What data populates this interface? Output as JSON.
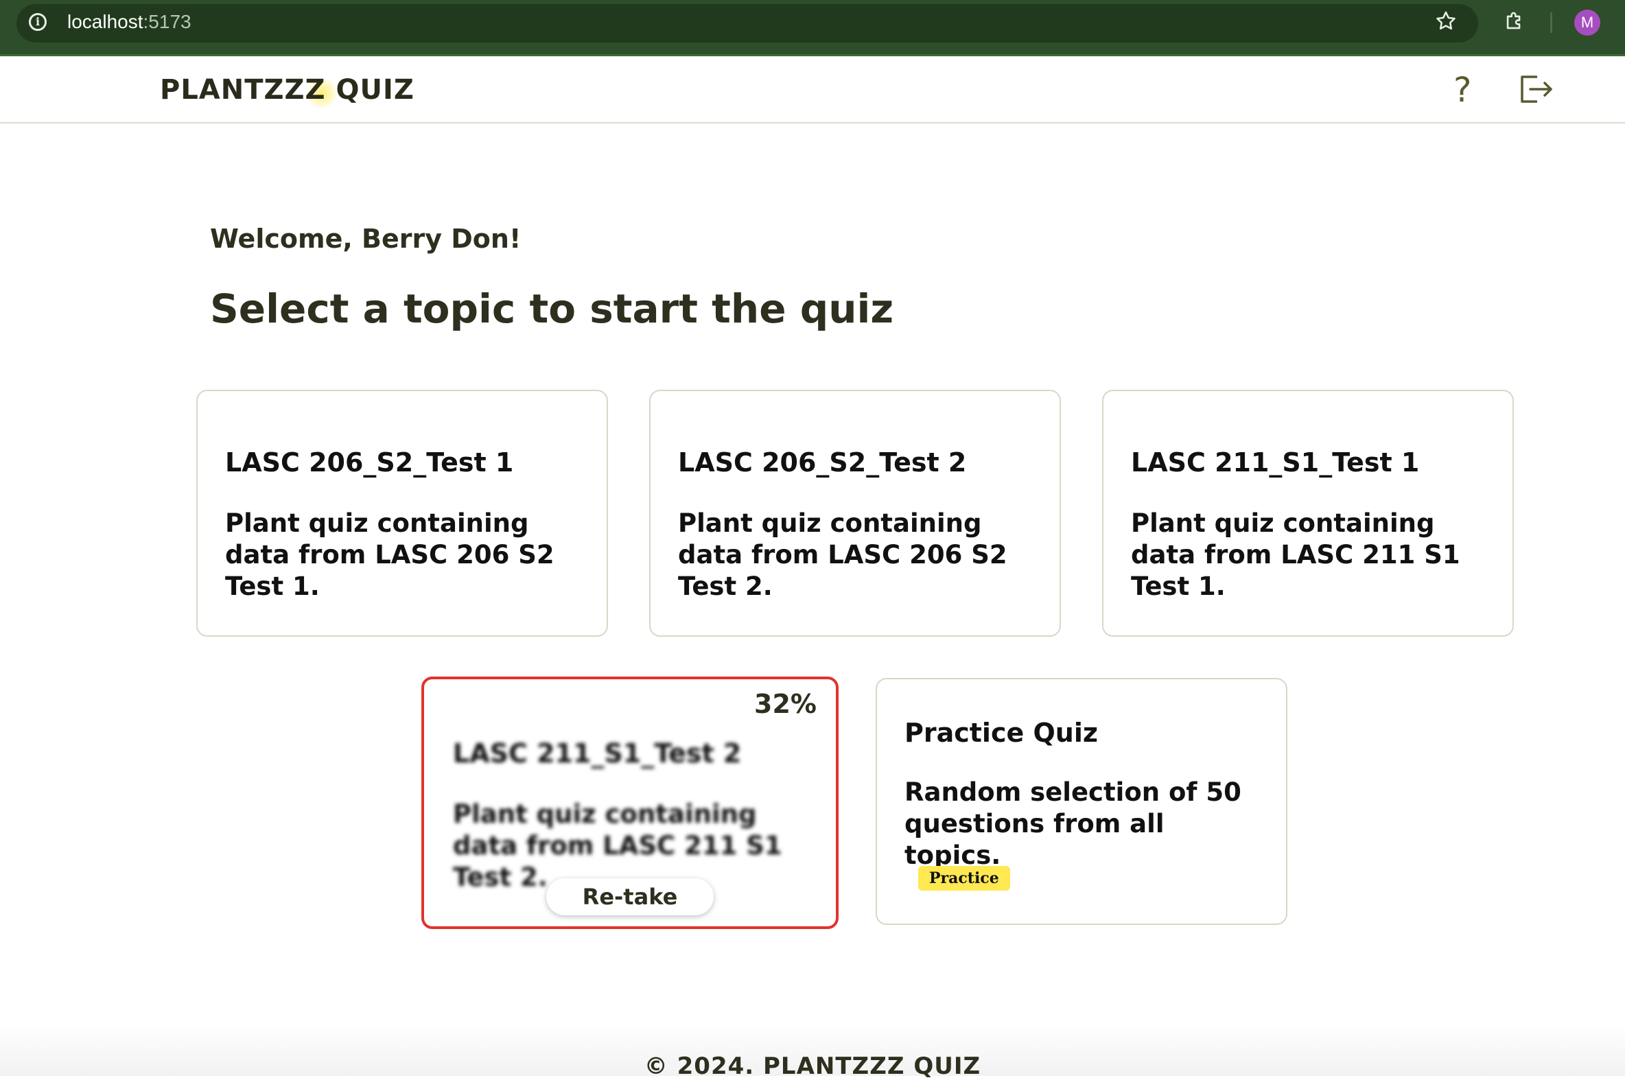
{
  "browser": {
    "url_host": "localhost",
    "url_port": ":5173",
    "profile_initial": "M",
    "icons": [
      "info-icon",
      "star-icon",
      "extensions-icon"
    ]
  },
  "header": {
    "logo": "PLANTZZZ QUIZ",
    "help_label": "?",
    "icons": [
      "help-icon",
      "logout-icon"
    ]
  },
  "main": {
    "welcome": "Welcome, Berry Don!",
    "headline": "Select a topic to start the quiz"
  },
  "cards": [
    {
      "title": "LASC 206_S2_Test 1",
      "description": "Plant quiz containing data from LASC 206 S2 Test 1."
    },
    {
      "title": "LASC 206_S2_Test 2",
      "description": "Plant quiz containing data from LASC 206 S2 Test 2."
    },
    {
      "title": "LASC 211_S1_Test 1",
      "description": "Plant quiz containing data from LASC 211 S1 Test 1."
    },
    {
      "title": "LASC 211_S1_Test 2",
      "description": "Plant quiz containing data from LASC 211 S1 Test 2.",
      "score": "32%",
      "action": "Re-take"
    },
    {
      "title": "Practice Quiz",
      "description": "Random selection of 50 questions from all topics.",
      "badge": "Practice"
    }
  ],
  "footer": {
    "text": "© 2024. PLANTZZZ QUIZ"
  },
  "colors": {
    "chrome": "#2e4d2a",
    "text": "#2f2f1f",
    "active_border": "#e0342c",
    "badge": "#ffe852"
  }
}
